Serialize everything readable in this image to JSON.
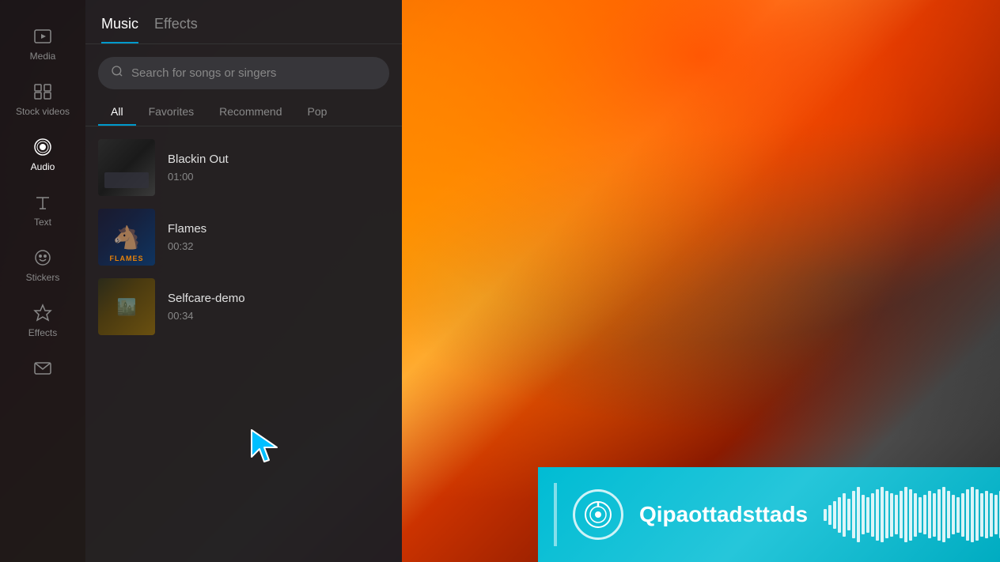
{
  "sidebar": {
    "items": [
      {
        "id": "media",
        "label": "Media",
        "icon": "media"
      },
      {
        "id": "stock-videos",
        "label": "Stock videos",
        "icon": "stock"
      },
      {
        "id": "audio",
        "label": "Audio",
        "icon": "audio",
        "active": true
      },
      {
        "id": "text",
        "label": "Text",
        "icon": "text"
      },
      {
        "id": "stickers",
        "label": "Stickers",
        "icon": "stickers"
      },
      {
        "id": "effects",
        "label": "Effects",
        "icon": "effects"
      },
      {
        "id": "mail",
        "label": "",
        "icon": "mail"
      }
    ]
  },
  "panel": {
    "tabs": [
      {
        "id": "music",
        "label": "Music",
        "active": true
      },
      {
        "id": "effects",
        "label": "Effects",
        "active": false
      }
    ],
    "search": {
      "placeholder": "Search for songs or singers"
    },
    "filter_tabs": [
      {
        "id": "all",
        "label": "All",
        "active": true
      },
      {
        "id": "favorites",
        "label": "Favorites",
        "active": false
      },
      {
        "id": "recommend",
        "label": "Recommend",
        "active": false
      },
      {
        "id": "pop",
        "label": "Pop",
        "active": false
      }
    ],
    "songs": [
      {
        "id": "blackin-out",
        "name": "Blackin Out",
        "duration": "01:00",
        "thumb_type": "blackin"
      },
      {
        "id": "flames",
        "name": "Flames",
        "duration": "00:32",
        "thumb_type": "flames"
      },
      {
        "id": "selfcare-demo",
        "name": "Selfcare-demo",
        "duration": "00:34",
        "thumb_type": "selfcare"
      }
    ]
  },
  "music_bar": {
    "title": "Qipaottadsttads",
    "logo_icon": "music-note"
  }
}
